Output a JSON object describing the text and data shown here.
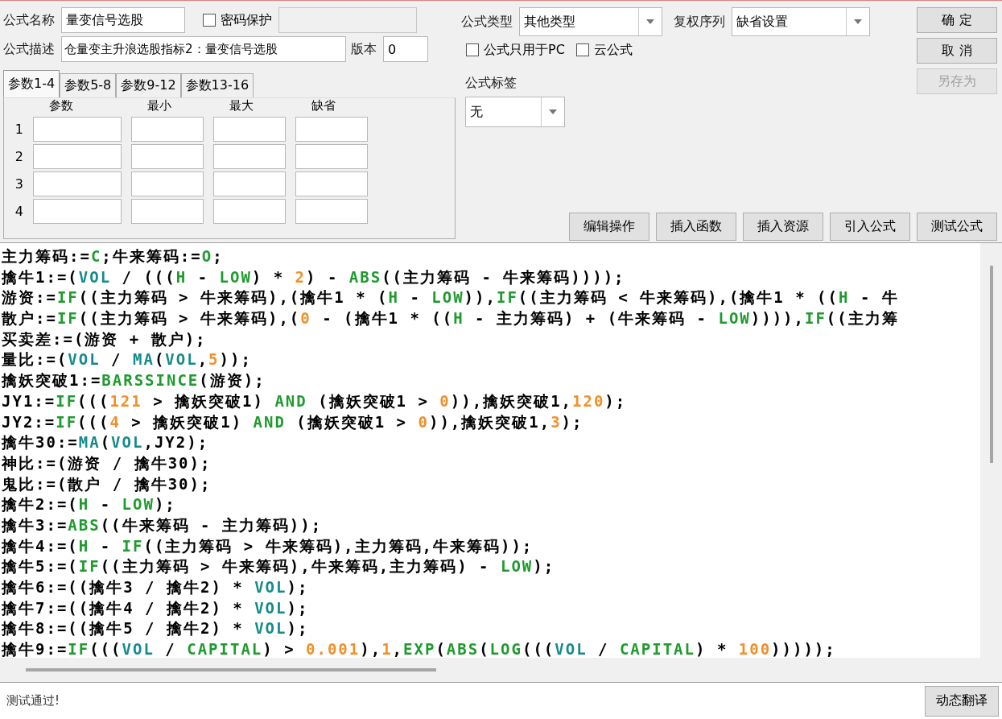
{
  "form": {
    "name_label": "公式名称",
    "name_value": "量变信号选股",
    "password": {
      "label": "密码保护",
      "checked": false
    },
    "password_field": {
      "disabled": true
    },
    "desc_label": "公式描述",
    "desc_value": "仓量变主升浪选股指标2：量变信号选股",
    "version_label": "版本",
    "version_value": "0"
  },
  "param_tabs": [
    {
      "label": "参数1-4",
      "selected": true
    },
    {
      "label": "参数5-8",
      "selected": false
    },
    {
      "label": "参数9-12",
      "selected": false
    },
    {
      "label": "参数13-16",
      "selected": false
    }
  ],
  "param_table": {
    "columns": [
      "参数",
      "最小",
      "最大",
      "缺省"
    ],
    "rows": [
      {
        "index": "1"
      },
      {
        "index": "2"
      },
      {
        "index": "3"
      },
      {
        "index": "4"
      }
    ]
  },
  "formula_type": {
    "label": "公式类型",
    "value": "其他类型"
  },
  "adjust": {
    "label": "复权序列",
    "value": "缺省设置"
  },
  "options": [
    {
      "label": "公式只用于PC",
      "checked": false
    },
    {
      "label": "云公式",
      "checked": false
    }
  ],
  "tag": {
    "label": "公式标签",
    "value": "无"
  },
  "side_buttons": [
    {
      "label": "确 定",
      "disabled": false
    },
    {
      "label": "取 消",
      "disabled": false
    },
    {
      "label": "另存为",
      "disabled": true
    }
  ],
  "tool_buttons": [
    "编辑操作",
    "插入函数",
    "插入资源",
    "引入公式",
    "测试公式"
  ],
  "code_lines": [
    [
      {
        "text": "主力筹码:=",
        "kind": "plain"
      },
      {
        "text": "C",
        "kind": "func"
      },
      {
        "text": ";牛来筹码:=",
        "kind": "plain"
      },
      {
        "text": "O",
        "kind": "func"
      },
      {
        "text": ";",
        "kind": "plain"
      }
    ],
    [
      {
        "text": "擒牛1:=(",
        "kind": "plain"
      },
      {
        "text": "VOL",
        "kind": "series"
      },
      {
        "text": " / (((",
        "kind": "plain"
      },
      {
        "text": "H",
        "kind": "func"
      },
      {
        "text": " - ",
        "kind": "plain"
      },
      {
        "text": "LOW",
        "kind": "func"
      },
      {
        "text": ") * ",
        "kind": "plain"
      },
      {
        "text": "2",
        "kind": "num"
      },
      {
        "text": ") - ",
        "kind": "plain"
      },
      {
        "text": "ABS",
        "kind": "func"
      },
      {
        "text": "((主力筹码 - 牛来筹码))));",
        "kind": "plain"
      }
    ],
    [
      {
        "text": "游资:=",
        "kind": "plain"
      },
      {
        "text": "IF",
        "kind": "func"
      },
      {
        "text": "((主力筹码 > 牛来筹码),(擒牛1 * (",
        "kind": "plain"
      },
      {
        "text": "H",
        "kind": "func"
      },
      {
        "text": " - ",
        "kind": "plain"
      },
      {
        "text": "LOW",
        "kind": "func"
      },
      {
        "text": ")),",
        "kind": "plain"
      },
      {
        "text": "IF",
        "kind": "func"
      },
      {
        "text": "((主力筹码 < 牛来筹码),(擒牛1 * ((",
        "kind": "plain"
      },
      {
        "text": "H",
        "kind": "func"
      },
      {
        "text": " - 牛",
        "kind": "plain"
      }
    ],
    [
      {
        "text": "散户:=",
        "kind": "plain"
      },
      {
        "text": "IF",
        "kind": "func"
      },
      {
        "text": "((主力筹码 > 牛来筹码),(",
        "kind": "plain"
      },
      {
        "text": "0",
        "kind": "num"
      },
      {
        "text": " - (擒牛1 * ((",
        "kind": "plain"
      },
      {
        "text": "H",
        "kind": "func"
      },
      {
        "text": " - 主力筹码) + (牛来筹码 - ",
        "kind": "plain"
      },
      {
        "text": "LOW",
        "kind": "func"
      },
      {
        "text": ")))),",
        "kind": "plain"
      },
      {
        "text": "IF",
        "kind": "func"
      },
      {
        "text": "((主力筹",
        "kind": "plain"
      }
    ],
    [
      {
        "text": "买卖差:=(游资 + 散户);",
        "kind": "plain"
      }
    ],
    [
      {
        "text": "量比:=(",
        "kind": "plain"
      },
      {
        "text": "VOL",
        "kind": "series"
      },
      {
        "text": " / ",
        "kind": "plain"
      },
      {
        "text": "MA",
        "kind": "series"
      },
      {
        "text": "(",
        "kind": "plain"
      },
      {
        "text": "VOL",
        "kind": "series"
      },
      {
        "text": ",",
        "kind": "plain"
      },
      {
        "text": "5",
        "kind": "num"
      },
      {
        "text": "));",
        "kind": "plain"
      }
    ],
    [
      {
        "text": "擒妖突破1:=",
        "kind": "plain"
      },
      {
        "text": "BARSSINCE",
        "kind": "func"
      },
      {
        "text": "(游资);",
        "kind": "plain"
      }
    ],
    [
      {
        "text": "JY1:=",
        "kind": "plain"
      },
      {
        "text": "IF",
        "kind": "func"
      },
      {
        "text": "(((",
        "kind": "plain"
      },
      {
        "text": "121",
        "kind": "num"
      },
      {
        "text": " > 擒妖突破1) ",
        "kind": "plain"
      },
      {
        "text": "AND",
        "kind": "func"
      },
      {
        "text": " (擒妖突破1 > ",
        "kind": "plain"
      },
      {
        "text": "0",
        "kind": "num"
      },
      {
        "text": ")),擒妖突破1,",
        "kind": "plain"
      },
      {
        "text": "120",
        "kind": "num"
      },
      {
        "text": ");",
        "kind": "plain"
      }
    ],
    [
      {
        "text": "JY2:=",
        "kind": "plain"
      },
      {
        "text": "IF",
        "kind": "func"
      },
      {
        "text": "(((",
        "kind": "plain"
      },
      {
        "text": "4",
        "kind": "num"
      },
      {
        "text": " > 擒妖突破1) ",
        "kind": "plain"
      },
      {
        "text": "AND",
        "kind": "func"
      },
      {
        "text": " (擒妖突破1 > ",
        "kind": "plain"
      },
      {
        "text": "0",
        "kind": "num"
      },
      {
        "text": ")),擒妖突破1,",
        "kind": "plain"
      },
      {
        "text": "3",
        "kind": "num"
      },
      {
        "text": ");",
        "kind": "plain"
      }
    ],
    [
      {
        "text": "擒牛30:=",
        "kind": "plain"
      },
      {
        "text": "MA",
        "kind": "series"
      },
      {
        "text": "(",
        "kind": "plain"
      },
      {
        "text": "VOL",
        "kind": "series"
      },
      {
        "text": ",JY2);",
        "kind": "plain"
      }
    ],
    [
      {
        "text": "神比:=(游资 / 擒牛30);",
        "kind": "plain"
      }
    ],
    [
      {
        "text": "鬼比:=(散户 / 擒牛30);",
        "kind": "plain"
      }
    ],
    [
      {
        "text": "擒牛2:=(",
        "kind": "plain"
      },
      {
        "text": "H",
        "kind": "func"
      },
      {
        "text": " - ",
        "kind": "plain"
      },
      {
        "text": "LOW",
        "kind": "func"
      },
      {
        "text": ");",
        "kind": "plain"
      }
    ],
    [
      {
        "text": "擒牛3:=",
        "kind": "plain"
      },
      {
        "text": "ABS",
        "kind": "func"
      },
      {
        "text": "((牛来筹码 - 主力筹码));",
        "kind": "plain"
      }
    ],
    [
      {
        "text": "擒牛4:=(",
        "kind": "plain"
      },
      {
        "text": "H",
        "kind": "func"
      },
      {
        "text": " - ",
        "kind": "plain"
      },
      {
        "text": "IF",
        "kind": "func"
      },
      {
        "text": "((主力筹码 > 牛来筹码),主力筹码,牛来筹码));",
        "kind": "plain"
      }
    ],
    [
      {
        "text": "擒牛5:=(",
        "kind": "plain"
      },
      {
        "text": "IF",
        "kind": "func"
      },
      {
        "text": "((主力筹码 > 牛来筹码),牛来筹码,主力筹码) - ",
        "kind": "plain"
      },
      {
        "text": "LOW",
        "kind": "func"
      },
      {
        "text": ");",
        "kind": "plain"
      }
    ],
    [
      {
        "text": "擒牛6:=((擒牛3 / 擒牛2) * ",
        "kind": "plain"
      },
      {
        "text": "VOL",
        "kind": "series"
      },
      {
        "text": ");",
        "kind": "plain"
      }
    ],
    [
      {
        "text": "擒牛7:=((擒牛4 / 擒牛2) * ",
        "kind": "plain"
      },
      {
        "text": "VOL",
        "kind": "series"
      },
      {
        "text": ");",
        "kind": "plain"
      }
    ],
    [
      {
        "text": "擒牛8:=((擒牛5 / 擒牛2) * ",
        "kind": "plain"
      },
      {
        "text": "VOL",
        "kind": "series"
      },
      {
        "text": ");",
        "kind": "plain"
      }
    ],
    [
      {
        "text": "擒牛9:=",
        "kind": "plain"
      },
      {
        "text": "IF",
        "kind": "func"
      },
      {
        "text": "(((",
        "kind": "plain"
      },
      {
        "text": "VOL",
        "kind": "series"
      },
      {
        "text": " / ",
        "kind": "plain"
      },
      {
        "text": "CAPITAL",
        "kind": "func"
      },
      {
        "text": ") > ",
        "kind": "plain"
      },
      {
        "text": "0.001",
        "kind": "num"
      },
      {
        "text": "),",
        "kind": "plain"
      },
      {
        "text": "1",
        "kind": "num"
      },
      {
        "text": ",",
        "kind": "plain"
      },
      {
        "text": "EXP",
        "kind": "func"
      },
      {
        "text": "(",
        "kind": "plain"
      },
      {
        "text": "ABS",
        "kind": "func"
      },
      {
        "text": "(",
        "kind": "plain"
      },
      {
        "text": "LOG",
        "kind": "func"
      },
      {
        "text": "(((",
        "kind": "plain"
      },
      {
        "text": "VOL",
        "kind": "series"
      },
      {
        "text": " / ",
        "kind": "plain"
      },
      {
        "text": "CAPITAL",
        "kind": "func"
      },
      {
        "text": ") * ",
        "kind": "plain"
      },
      {
        "text": "100",
        "kind": "num"
      },
      {
        "text": ")))));",
        "kind": "plain"
      }
    ]
  ],
  "status": {
    "message": "测试通过!",
    "button": "动态翻译"
  }
}
